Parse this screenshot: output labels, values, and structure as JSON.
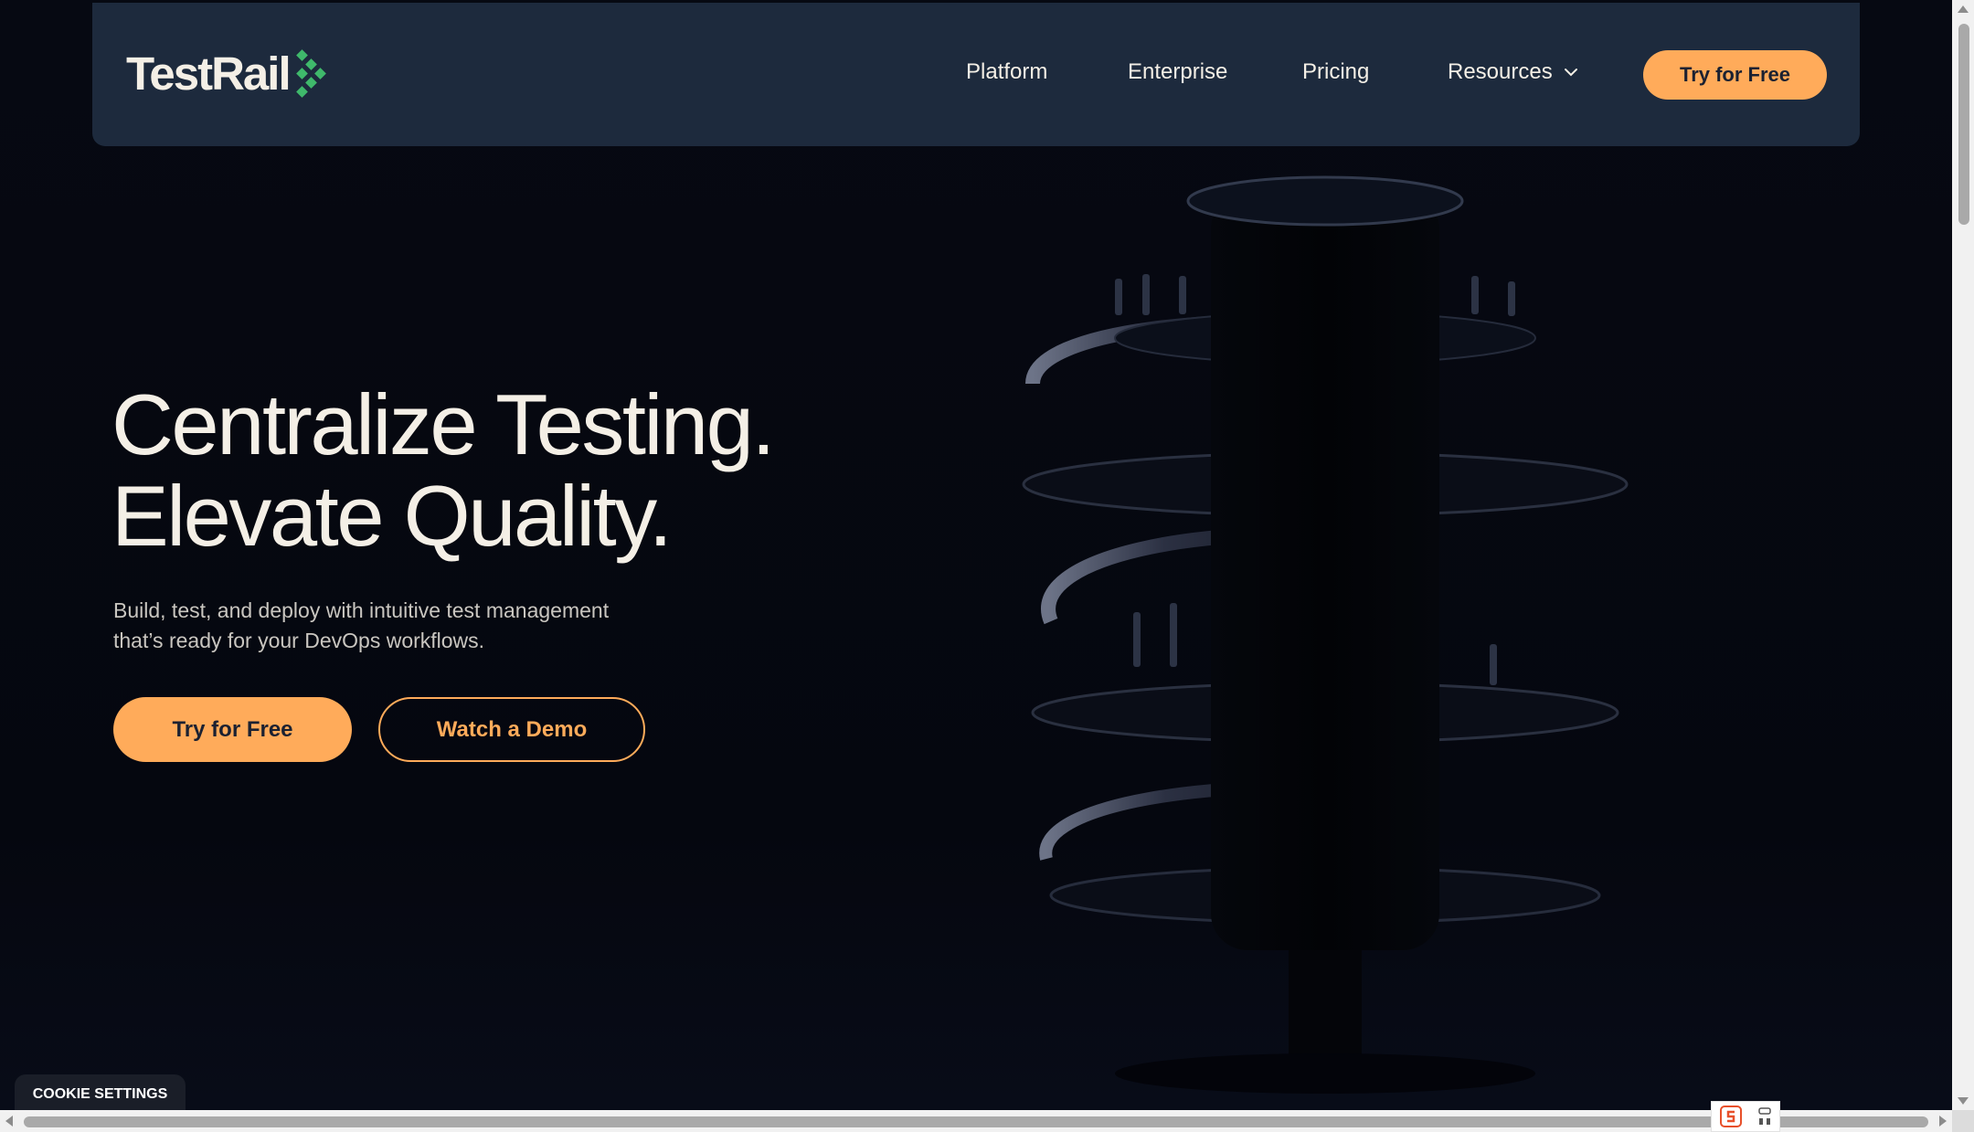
{
  "nav": {
    "logo_text": "TestRail",
    "links": [
      {
        "label": "Platform"
      },
      {
        "label": "Enterprise"
      },
      {
        "label": "Pricing"
      },
      {
        "label": "Resources"
      }
    ],
    "cta_label": "Try for Free"
  },
  "hero": {
    "title_line1": "Centralize Testing.",
    "title_line2": "Elevate Quality.",
    "subtitle_line1": "Build, test, and deploy with intuitive test management",
    "subtitle_line2": "that’s ready for your DevOps workflows.",
    "primary_button": "Try for Free",
    "secondary_button": "Watch a Demo"
  },
  "cookie_button": "COOKIE SETTINGS",
  "colors": {
    "accent": "#ffab5a",
    "nav_bg": "#1d2a3d",
    "page_bg": "#05070f",
    "logo_green": "#3fb96b",
    "text": "#f4efe6"
  },
  "icons": {
    "logo_mark": "testrail-diamond-icon",
    "dropdown": "chevron-down-icon",
    "extension_1": "extension-s-icon",
    "extension_2": "extension-grid-icon"
  }
}
